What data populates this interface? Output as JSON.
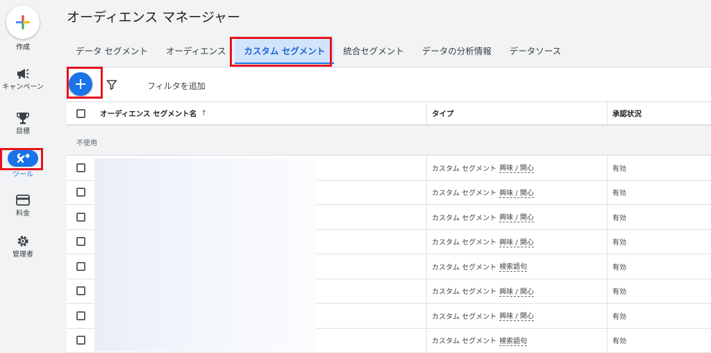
{
  "sidebar": {
    "create_label": "作成",
    "items": [
      {
        "label": "キャンペーン",
        "icon": "megaphone-icon"
      },
      {
        "label": "目標",
        "icon": "trophy-icon"
      },
      {
        "label": "ツール",
        "icon": "tools-icon"
      },
      {
        "label": "料金",
        "icon": "credit-card-icon"
      },
      {
        "label": "管理者",
        "icon": "gear-icon"
      }
    ]
  },
  "page_title": "オーディエンス マネージャー",
  "tabs": [
    {
      "label": "データ セグメント"
    },
    {
      "label": "オーディエンス"
    },
    {
      "label": "カスタム セグメント"
    },
    {
      "label": "統合セグメント"
    },
    {
      "label": "データの分析情報"
    },
    {
      "label": "データソース"
    }
  ],
  "active_tab": "カスタム セグメント",
  "toolbar": {
    "add_filter_label": "フィルタを追加"
  },
  "table": {
    "columns": {
      "name": "オーディエンス セグメント名",
      "sort_indicator": "↑",
      "type": "タイプ",
      "status": "承認状況"
    },
    "group_label": "不使用",
    "rows": [
      {
        "type_prefix": "カスタム セグメント",
        "type_detail": "興味 / 関心",
        "status": "有効"
      },
      {
        "type_prefix": "カスタム セグメント",
        "type_detail": "興味 / 関心",
        "status": "有効"
      },
      {
        "type_prefix": "カスタム セグメント",
        "type_detail": "興味 / 関心",
        "status": "有効"
      },
      {
        "type_prefix": "カスタム セグメント",
        "type_detail": "興味 / 関心",
        "status": "有効"
      },
      {
        "type_prefix": "カスタム セグメント",
        "type_detail": "検索語句",
        "status": "有効"
      },
      {
        "type_prefix": "カスタム セグメント",
        "type_detail": "興味 / 関心",
        "status": "有効"
      },
      {
        "type_prefix": "カスタム セグメント",
        "type_detail": "興味 / 関心",
        "status": "有効"
      },
      {
        "type_prefix": "カスタム セグメント",
        "type_detail": "検索語句",
        "status": "有効"
      }
    ]
  },
  "colors": {
    "accent": "#1a73e8",
    "highlight": "#e8101b",
    "active_tab_bg": "#d2e3fc"
  }
}
